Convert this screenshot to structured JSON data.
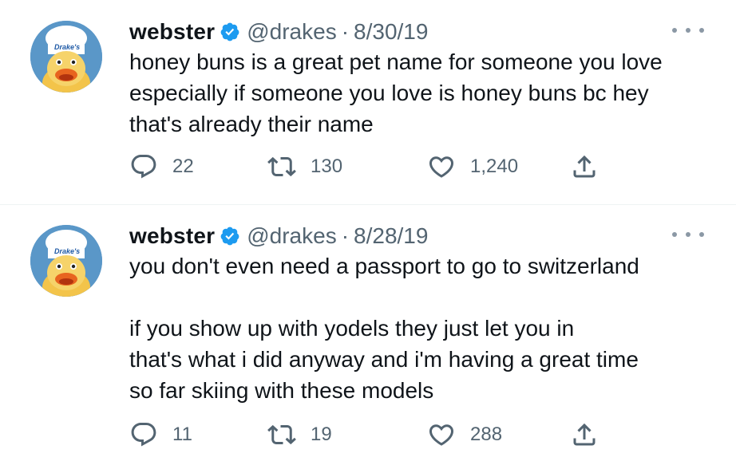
{
  "tweets": [
    {
      "name": "webster",
      "handle": "@drakes",
      "separator": "·",
      "date": "8/30/19",
      "avatar_label": "Drake's",
      "text_paragraphs": [
        "honey buns is a great pet name for someone you love\nespecially if someone you love is honey buns bc hey\nthat's already their name"
      ],
      "replies": "22",
      "retweets": "130",
      "likes": "1,240"
    },
    {
      "name": "webster",
      "handle": "@drakes",
      "separator": "·",
      "date": "8/28/19",
      "avatar_label": "Drake's",
      "text_paragraphs": [
        "you don't even need a passport to go to switzerland",
        "if you show up with yodels they just let you in\nthat's what i did anyway and i'm having a great time\nso far skiing with these models"
      ],
      "replies": "11",
      "retweets": "19",
      "likes": "288"
    }
  ],
  "icons": {
    "verified": "verified-badge-icon",
    "more": "more-options-icon",
    "reply": "reply-icon",
    "retweet": "retweet-icon",
    "like": "like-icon",
    "share": "share-icon"
  },
  "colors": {
    "text": "#0f1419",
    "secondary": "#536471",
    "verified": "#1d9bf0",
    "divider": "#eff3f4",
    "avatar_bg": "#5a97c8"
  }
}
